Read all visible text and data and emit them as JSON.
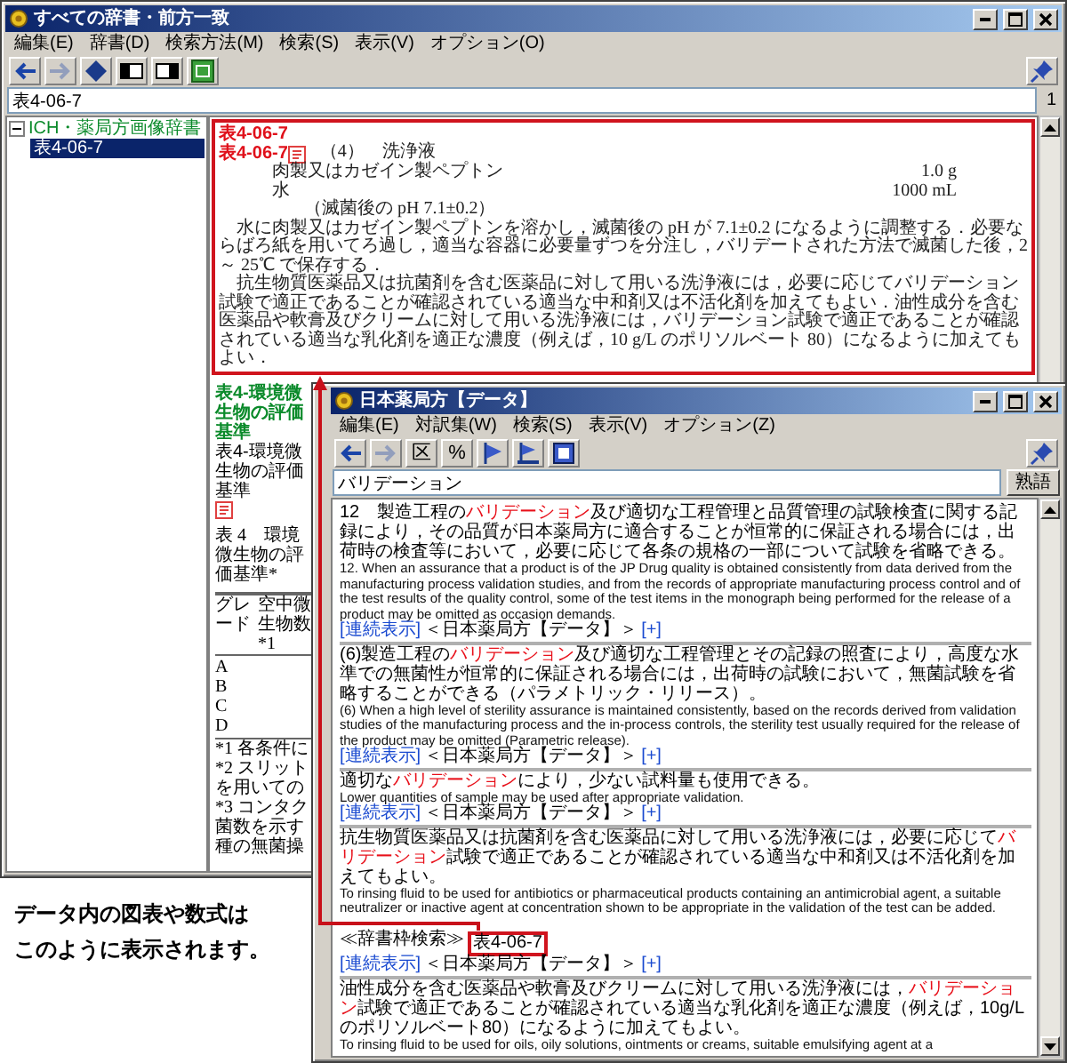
{
  "back_window": {
    "title": "すべての辞書・前方一致",
    "menu": [
      "編集(E)",
      "辞書(D)",
      "検索方法(M)",
      "検索(S)",
      "表示(V)",
      "オプション(O)"
    ],
    "toolbar": [
      {
        "kind": "back",
        "disabled": false
      },
      {
        "kind": "forward",
        "disabled": true
      },
      {
        "kind": "diamond"
      },
      {
        "kind": "pane-left"
      },
      {
        "kind": "pane-right"
      },
      {
        "kind": "green-window"
      }
    ],
    "search": {
      "value": "表4-06-7",
      "count": "1"
    },
    "tree": [
      {
        "label": "ICH・薬局方画像辞書",
        "expanded": true,
        "children": [
          {
            "label": "表4-06-7",
            "selected": true
          }
        ]
      }
    ],
    "entries": [
      {
        "kind": "figure",
        "highlighted": true,
        "heading": "表4-06-7",
        "link": "表4-06-7",
        "figure": {
          "lines": [
            {
              "kind": "heading",
              "text": "（4）　洗浄液"
            },
            {
              "kind": "row",
              "name": "肉製又はカゼイン製ペプトン",
              "amount": "1.0 g"
            },
            {
              "kind": "row",
              "name": "水",
              "amount": "1000 mL"
            },
            {
              "kind": "note",
              "text": "（滅菌後の pH 7.1±0.2）"
            },
            {
              "kind": "para",
              "text": "水に肉製又はカゼイン製ペプトンを溶かし，滅菌後の pH が 7.1±0.2 になるように調整する．必要ならばろ紙を用いてろ過し，適当な容器に必要量ずつを分注し，バリデートされた方法で滅菌した後，2 ～ 25℃ で保存する．"
            },
            {
              "kind": "para",
              "text": "抗生物質医薬品又は抗菌剤を含む医薬品に対して用いる洗浄液には，必要に応じてバリデーション試験で適正であることが確認されている適当な中和剤又は不活化剤を加えてもよい．油性成分を含む医薬品や軟膏及びクリームに対して用いる洗浄液には，バリデーション試験で適正であることが確認されている適当な乳化剤を適正な濃度（例えば，10 g/L のポリソルベート 80）になるように加えてもよい．"
            }
          ]
        }
      },
      {
        "kind": "table",
        "highlighted": false,
        "heading": "表4-環境微生物の評価基準",
        "link": "表4-環境微生物の評価基準",
        "table": {
          "title": "表 4　環境微生物の評価基準*",
          "columns": [
            "グレード",
            "空中微生物数*1"
          ],
          "rows": [
            "A",
            "B",
            "C",
            "D"
          ],
          "footnotes": [
            "*1 各条件に",
            "*2 スリット",
            "を用いての",
            "*3 コンタク",
            "菌数を示す",
            "種の無菌操"
          ]
        }
      }
    ]
  },
  "caption": [
    "データ内の図表や数式は",
    "このように表示されます。"
  ],
  "front_window": {
    "title": "日本薬局方【データ】",
    "menu": [
      "編集(E)",
      "対訳集(W)",
      "検索(S)",
      "表示(V)",
      "オプション(Z)"
    ],
    "toolbar": [
      {
        "kind": "back",
        "disabled": false
      },
      {
        "kind": "forward",
        "disabled": true
      },
      {
        "kind": "text",
        "label": "区"
      },
      {
        "kind": "text",
        "label": "%"
      },
      {
        "kind": "flag"
      },
      {
        "kind": "flag-stand"
      },
      {
        "kind": "book"
      }
    ],
    "search": {
      "value": "バリデーション"
    },
    "button": "熟語",
    "results": [
      {
        "ja": "12　製造工程の**バリデーション**及び適切な工程管理と品質管理の試験検査に関する記録により，その品質が日本薬局方に適合することが恒常的に保証される場合には，出荷時の検査等において，必要に応じて各条の規格の一部について試験を省略できる。",
        "en": "12. When an assurance that a product is of the JP Drug quality is obtained consistently from data derived from the manufacturing process validation studies, and from the records of appropriate manufacturing process control and of the test results of the quality control, some of the test items in the monograph being performed for the release of a product may be omitted as occasion demands.",
        "links": {
          "more": "[連続表示]",
          "source": "＜日本薬局方【データ】＞",
          "expand": "[+]"
        }
      },
      {
        "ja": "(6)製造工程の**バリデーション**及び適切な工程管理とその記録の照査により，高度な水準での無菌性が恒常的に保証される場合には，出荷時の試験において，無菌試験を省略することができる（パラメトリック・リリース）。",
        "en": "(6) When a high level of sterility assurance is maintained consistently, based on the records derived from validation studies of the manufacturing process and the in-process controls, the sterility test usually required for the release of the product may be omitted (Parametric release).",
        "links": {
          "more": "[連続表示]",
          "source": "＜日本薬局方【データ】＞",
          "expand": "[+]"
        }
      },
      {
        "ja": "適切な**バリデーション**により，少ない試料量も使用できる。",
        "en": "Lower quantities of sample may be used after appropriate validation.",
        "links": {
          "more": "[連続表示]",
          "source": "＜日本薬局方【データ】＞",
          "expand": "[+]"
        }
      },
      {
        "ja": "抗生物質医薬品又は抗菌剤を含む医薬品に対して用いる洗浄液には，必要に応じて**バリデーション**試験で適正であることが確認されている適当な中和剤又は不活化剤を加えてもよい。",
        "en": "To rinsing fluid to be used for antibiotics or pharmaceutical products containing an antimicrobial agent, a suitable neutralizer or inactive agent at concentration shown to be appropriate in the validation of the test can be added.",
        "ref": {
          "prefix": "≪辞書枠検索≫",
          "target": "表4-06-7"
        },
        "links": {
          "more": "[連続表示]",
          "source": "＜日本薬局方【データ】＞",
          "expand": "[+]"
        }
      },
      {
        "ja": "油性成分を含む医薬品や軟膏及びクリームに対して用いる洗浄液には，**バリデーション**試験で適正であることが確認されている適当な乳化剤を適正な濃度（例えば，10g/Lのポリソルベート80）になるように加えてもよい。",
        "en": "To rinsing fluid to be used for oils, oily solutions, ointments or creams, suitable emulsifying agent at a"
      }
    ]
  }
}
